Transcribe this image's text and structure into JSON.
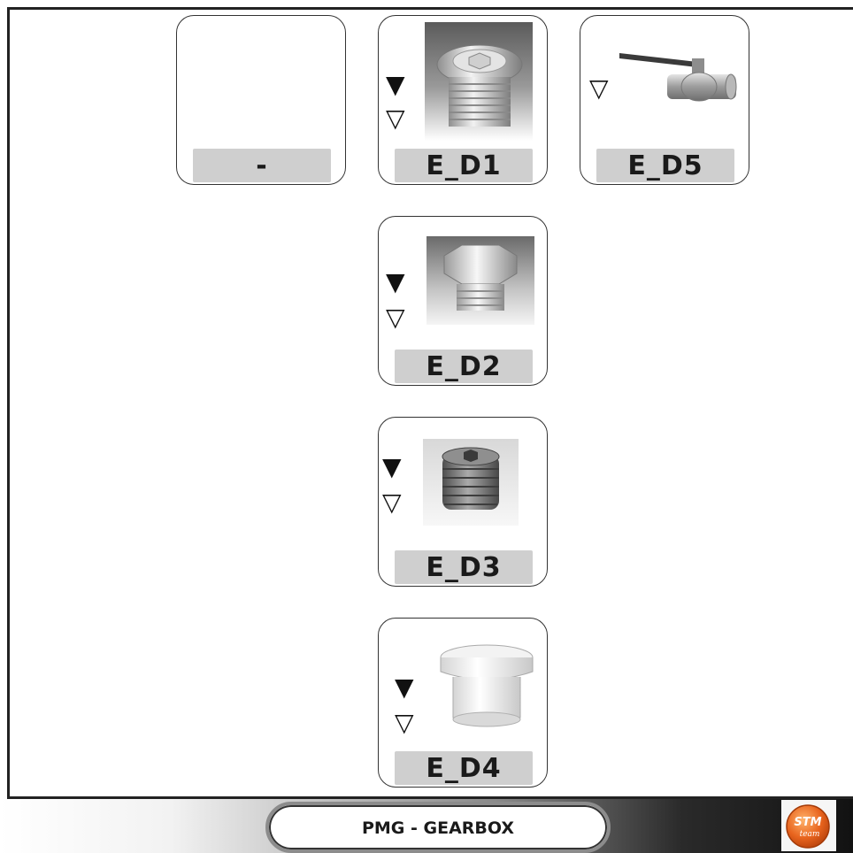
{
  "cards": [
    {
      "id": "empty",
      "label": "-"
    },
    {
      "id": "e_d1",
      "label": "E_D1",
      "arrow_up": "▼",
      "arrow_down": "▽"
    },
    {
      "id": "e_d5",
      "label": "E_D5",
      "arrow_down": "▽"
    },
    {
      "id": "e_d2",
      "label": "E_D2",
      "arrow_up": "▼",
      "arrow_down": "▽"
    },
    {
      "id": "e_d3",
      "label": "E_D3",
      "arrow_up": "▼",
      "arrow_down": "▽"
    },
    {
      "id": "e_d4",
      "label": "E_D4",
      "arrow_up": "▼",
      "arrow_down": "▽"
    }
  ],
  "footer": {
    "title": "PMG - GEARBOX",
    "logo_text": "STM team"
  },
  "colors": {
    "label_bg": "#cfcfcf",
    "logo": "#e8641e",
    "frame": "#222222"
  },
  "icons": {
    "filled": "filled-down-triangle-icon",
    "outline": "outline-down-triangle-icon"
  }
}
